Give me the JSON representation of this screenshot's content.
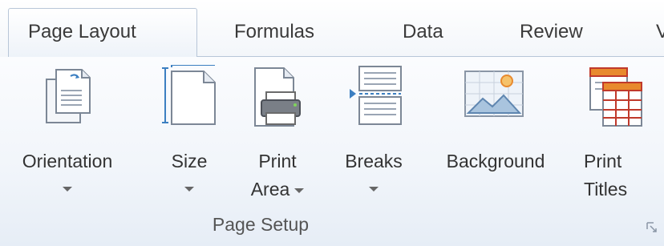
{
  "tabs": [
    {
      "label": "Page Layout",
      "active": true
    },
    {
      "label": "Formulas",
      "active": false
    },
    {
      "label": "Data",
      "active": false
    },
    {
      "label": "Review",
      "active": false
    },
    {
      "label": "V",
      "active": false
    }
  ],
  "group": {
    "label": "Page Setup",
    "buttons": [
      {
        "label": "Orientation",
        "line2": "",
        "has_dropdown": true,
        "icon": "orientation-icon"
      },
      {
        "label": "Size",
        "line2": "",
        "has_dropdown": true,
        "icon": "size-icon"
      },
      {
        "label": "Print",
        "line2": "Area",
        "has_dropdown": true,
        "icon": "print-area-icon"
      },
      {
        "label": "Breaks",
        "line2": "",
        "has_dropdown": true,
        "icon": "breaks-icon"
      },
      {
        "label": "Background",
        "line2": "",
        "has_dropdown": false,
        "icon": "background-icon"
      },
      {
        "label": "Print",
        "line2": "Titles",
        "has_dropdown": false,
        "icon": "print-titles-icon"
      }
    ]
  },
  "colors": {
    "accent_blue": "#3c7fc1",
    "icon_orange": "#e88a2e",
    "icon_red": "#c0392b"
  }
}
